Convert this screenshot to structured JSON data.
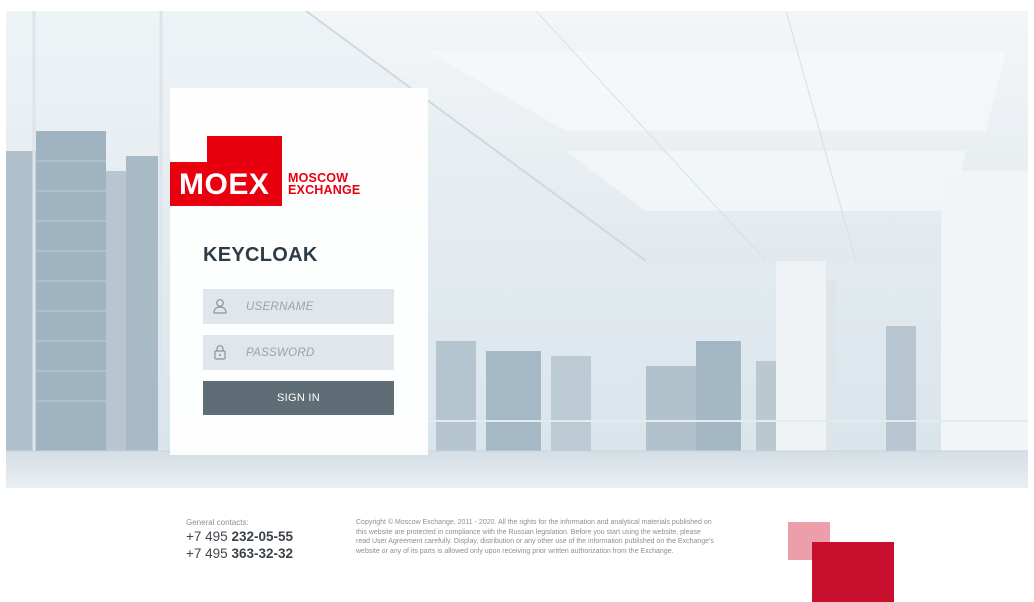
{
  "card": {
    "logo": {
      "mark": "MOEX",
      "line1": "MOSCOW",
      "line2": "EXCHANGE"
    },
    "title": "KEYCLOAK",
    "username": {
      "placeholder": "USERNAME",
      "value": ""
    },
    "password": {
      "placeholder": "PASSWORD",
      "value": ""
    },
    "signin_label": "SIGN IN"
  },
  "footer": {
    "contacts_label": "General contacts:",
    "phones": [
      {
        "prefix": "+7 495",
        "number": "232-05-55"
      },
      {
        "prefix": "+7 495",
        "number": "363-32-32"
      }
    ],
    "copyright": "Copyright © Moscow Exchange, 2011 - 2020. All the rights for the information and analytical materials published on this website are protected in compliance with the Russian legislation. Before you start using the website, please read User Agreement carefully. Display, distribution or any other use of the information published on the Exchange's website or any of its parts is allowed only upon receiving prior written authorization from the Exchange."
  },
  "colors": {
    "brand_red": "#e8000f",
    "button": "#5f6d77",
    "deco_pink": "#ec9ea9",
    "deco_red": "#c8102e"
  },
  "icons": {
    "username": "user-icon",
    "password": "lock-icon"
  }
}
